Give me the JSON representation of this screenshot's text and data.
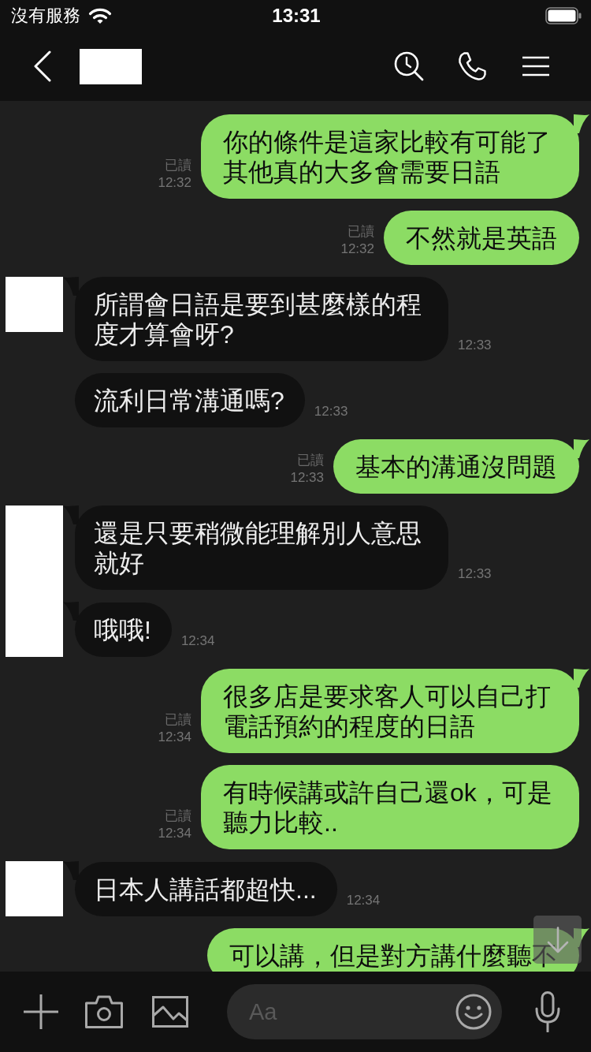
{
  "status_bar": {
    "carrier": "沒有服務",
    "time": "13:31"
  },
  "messages": [
    {
      "kind": "sent",
      "text": "你的條件是這家比較有可能了其他真的大多會需要日語",
      "read": "已讀",
      "time": "12:32",
      "tail": true
    },
    {
      "kind": "sent",
      "text": "不然就是英語",
      "read": "已讀",
      "time": "12:32",
      "tail": false
    },
    {
      "kind": "received",
      "text": "所謂會日語是要到甚麼樣的程度才算會呀?",
      "time": "12:33",
      "tail": true,
      "avatar": true
    },
    {
      "kind": "received",
      "text": "流利日常溝通嗎?",
      "time": "12:33",
      "tail": false,
      "avatar": false
    },
    {
      "kind": "sent",
      "text": "基本的溝通沒問題",
      "read": "已讀",
      "time": "12:33",
      "tail": true
    },
    {
      "kind": "received",
      "text": "還是只要稍微能理解別人意思就好",
      "time": "12:33",
      "tail": true,
      "avatar": true
    },
    {
      "kind": "received",
      "text": "哦哦!",
      "time": "12:34",
      "tail": true,
      "avatar": true
    },
    {
      "kind": "sent",
      "text": "很多店是要求客人可以自己打電話預約的程度的日語",
      "read": "已讀",
      "time": "12:34",
      "tail": true
    },
    {
      "kind": "sent",
      "text": "有時候講或許自己還ok，可是聽力比較..",
      "read": "已讀",
      "time": "12:34",
      "tail": false
    },
    {
      "kind": "received",
      "text": "日本人講話都超快...",
      "time": "12:34",
      "tail": true,
      "avatar": true
    },
    {
      "kind": "sent",
      "text": "可以講，但是對方講什麼聽不",
      "tail": true
    }
  ],
  "composer": {
    "placeholder": "Aa"
  }
}
